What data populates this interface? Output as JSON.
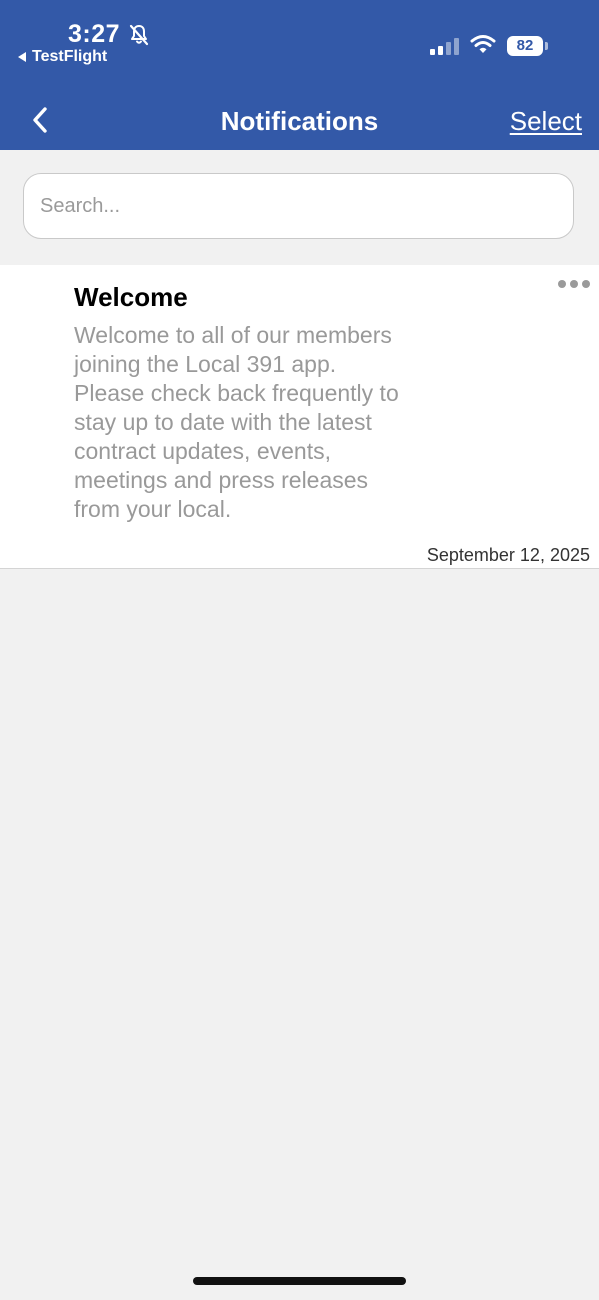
{
  "status_bar": {
    "time": "3:27",
    "back_app": "TestFlight",
    "battery": "82",
    "icons": [
      "bell-slash-icon",
      "cellular-signal-icon",
      "wifi-icon",
      "battery-icon"
    ]
  },
  "nav": {
    "title": "Notifications",
    "select_label": "Select",
    "back_icon": "chevron-left-icon"
  },
  "search": {
    "placeholder": "Search..."
  },
  "notifications": [
    {
      "title": "Welcome",
      "body": "Welcome to all of our members joining the Local 391 app. Please check back frequently to stay up to date with the latest contract updates, events, meetings and press releases from your local.",
      "date": "September 12, 2025",
      "more_icon": "ellipsis-icon"
    }
  ],
  "colors": {
    "header": "#3359a8",
    "background": "#f1f1f1",
    "card": "#ffffff",
    "muted_text": "#999999"
  }
}
